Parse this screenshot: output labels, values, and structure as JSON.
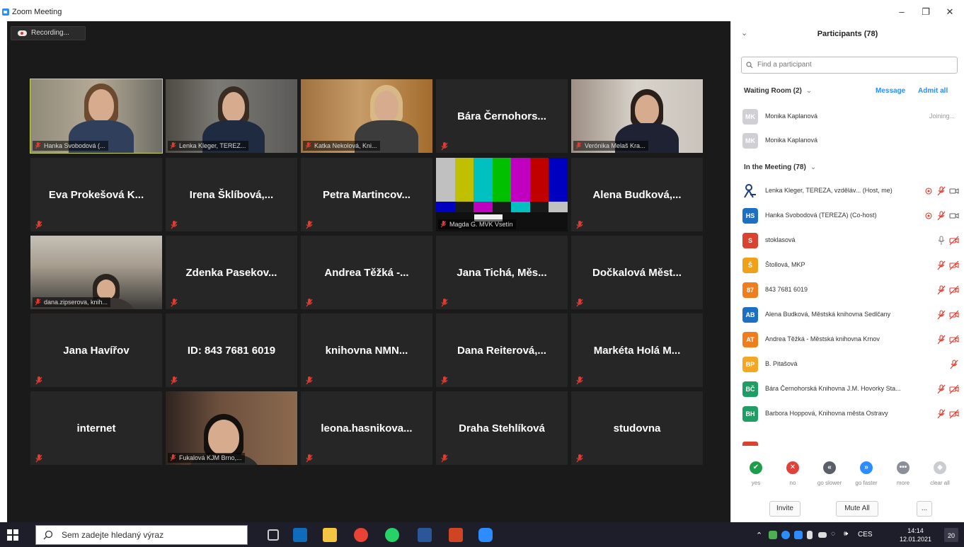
{
  "window": {
    "title": "Zoom Meeting",
    "minimize": "–",
    "restore": "❐",
    "close": "✕"
  },
  "recording": {
    "label": "Recording..."
  },
  "tiles": [
    {
      "name": "Hanka Svobodová (...",
      "kind": "video",
      "photo": "p1",
      "active": true
    },
    {
      "name": "Lenka Kleger, TEREZ...",
      "kind": "video",
      "photo": "p2"
    },
    {
      "name": "Katka Nekolová, Kni...",
      "kind": "video",
      "photo": "p3"
    },
    {
      "name": "Bára Černohors...",
      "kind": "name"
    },
    {
      "name": "Verónika Melaš Kra...",
      "kind": "video",
      "photo": "p5"
    },
    {
      "name": "Eva Prokešová K...",
      "kind": "name"
    },
    {
      "name": "Irena Šklíbová,...",
      "kind": "name"
    },
    {
      "name": "Petra Martincov...",
      "kind": "name"
    },
    {
      "name": "Magda G. MVK Vsetín",
      "kind": "bars"
    },
    {
      "name": "Alena Budková,...",
      "kind": "name"
    },
    {
      "name": "dana.zipserova, knih...",
      "kind": "video",
      "photo": "p6"
    },
    {
      "name": "Zdenka Pasekov...",
      "kind": "name"
    },
    {
      "name": "Andrea Těžká -...",
      "kind": "name"
    },
    {
      "name": "Jana Tichá, Měs...",
      "kind": "name"
    },
    {
      "name": "Dočkalová Měst...",
      "kind": "name"
    },
    {
      "name": "Jana Havířov",
      "kind": "name"
    },
    {
      "name": "ID: 843 7681 6019",
      "kind": "name"
    },
    {
      "name": "knihovna NMN...",
      "kind": "name"
    },
    {
      "name": "Dana Reiterová,...",
      "kind": "name"
    },
    {
      "name": "Markéta Holá M...",
      "kind": "name"
    },
    {
      "name": "internet",
      "kind": "name"
    },
    {
      "name": "Fukalová KJM Brno,...",
      "kind": "video",
      "photo": "p7"
    },
    {
      "name": "leona.hasnikova...",
      "kind": "name"
    },
    {
      "name": "Draha Stehlíková",
      "kind": "name"
    },
    {
      "name": "studovna",
      "kind": "name"
    }
  ],
  "panel": {
    "title": "Participants (78)",
    "search_placeholder": "Find a participant",
    "waiting_room": {
      "label": "Waiting Room (2)",
      "message": "Message",
      "admit_all": "Admit all",
      "people": [
        {
          "initials": "MK",
          "name": "Monika Kaplanová",
          "status": "Joining..."
        },
        {
          "initials": "MK",
          "name": "Monika Kaplanová",
          "status": ""
        }
      ]
    },
    "in_meeting": {
      "label": "In the Meeting (78)",
      "people": [
        {
          "initials": "",
          "name": "Lenka Kleger, TEREZA, vzděláv... (Host, me)",
          "color": "#ffffff",
          "icons": [
            "share",
            "mic-off",
            "cam"
          ]
        },
        {
          "initials": "HS",
          "name": "Hanka Svobodová (TEREZA) (Co-host)",
          "color": "#1d6fc1",
          "icons": [
            "share",
            "mic-off",
            "cam"
          ]
        },
        {
          "initials": "S",
          "name": "stoklasová",
          "color": "#d9432f",
          "icons": [
            "mic",
            "cam-off"
          ]
        },
        {
          "initials": "Š",
          "name": "Štollová, MKP",
          "color": "#f0a11c",
          "icons": [
            "mic-off",
            "cam-off"
          ]
        },
        {
          "initials": "87",
          "name": "843 7681 6019",
          "color": "#f07e1c",
          "icons": [
            "mic-off",
            "cam-off"
          ]
        },
        {
          "initials": "AB",
          "name": "Alena Budková, Městská knihovna Sedlčany",
          "color": "#1d6fc1",
          "icons": [
            "mic-off",
            "cam-off"
          ]
        },
        {
          "initials": "AT",
          "name": "Andrea Těžká - Městská knihovna Krnov",
          "color": "#f07e1c",
          "icons": [
            "mic-off",
            "cam-off"
          ]
        },
        {
          "initials": "BP",
          "name": "B. Pitašová",
          "color": "#f5a623",
          "icons": [
            "mic-off"
          ]
        },
        {
          "initials": "BČ",
          "name": "Bára Černohorská Knihovna J.M. Hovorky Sta...",
          "color": "#1e9e63",
          "icons": [
            "mic-off",
            "cam-off"
          ]
        },
        {
          "initials": "BH",
          "name": "Barbora Hoppová, Knihovna města Ostravy",
          "color": "#1e9e63",
          "icons": [
            "mic-off",
            "cam-off"
          ]
        }
      ]
    },
    "reactions": [
      {
        "label": "yes",
        "glyph": "✔",
        "color": "#1e9e4a"
      },
      {
        "label": "no",
        "glyph": "✕",
        "color": "#e0423a"
      },
      {
        "label": "go slower",
        "glyph": "«",
        "color": "#5a5f6a"
      },
      {
        "label": "go faster",
        "glyph": "»",
        "color": "#2D8CFF"
      },
      {
        "label": "more",
        "glyph": "•••",
        "color": "#8a8f99"
      },
      {
        "label": "clear all",
        "glyph": "◆",
        "color": "#c9ccd2"
      }
    ],
    "buttons": {
      "invite": "Invite",
      "mute_all": "Mute All",
      "more": "..."
    }
  },
  "taskbar": {
    "search_placeholder": "Sem zadejte hledaný výraz",
    "lang": "CES",
    "time": "14:14",
    "date": "12.01.2021",
    "notifications": "20"
  }
}
